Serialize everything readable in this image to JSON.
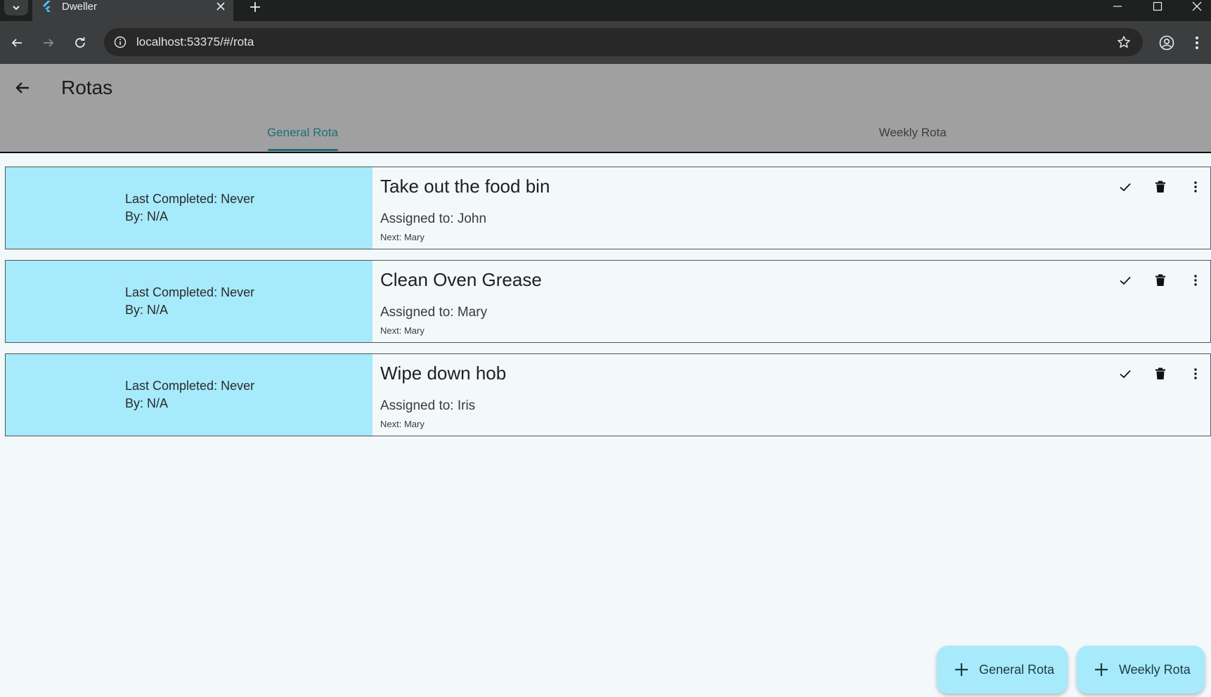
{
  "browser": {
    "tab_title": "Dweller",
    "url": "localhost:53375/#/rota"
  },
  "appbar": {
    "title": "Rotas"
  },
  "tabs": [
    {
      "label": "General Rota",
      "active": true
    },
    {
      "label": "Weekly Rota",
      "active": false
    }
  ],
  "rotas": [
    {
      "last_completed": "Last Completed: Never",
      "by": "By: N/A",
      "title": "Take out the food bin",
      "assigned": "Assigned to: John",
      "next": "Next: Mary"
    },
    {
      "last_completed": "Last Completed: Never",
      "by": "By: N/A",
      "title": "Clean Oven Grease",
      "assigned": "Assigned to: Mary",
      "next": "Next: Mary"
    },
    {
      "last_completed": "Last Completed: Never",
      "by": "By: N/A",
      "title": "Wipe down hob",
      "assigned": "Assigned to: Iris",
      "next": "Next: Mary"
    }
  ],
  "fabs": {
    "general": "General Rota",
    "weekly": "Weekly Rota"
  },
  "colors": {
    "accent": "#1f6f7a",
    "card_panel": "#a6eafb",
    "appbar": "#a0a0a0"
  }
}
